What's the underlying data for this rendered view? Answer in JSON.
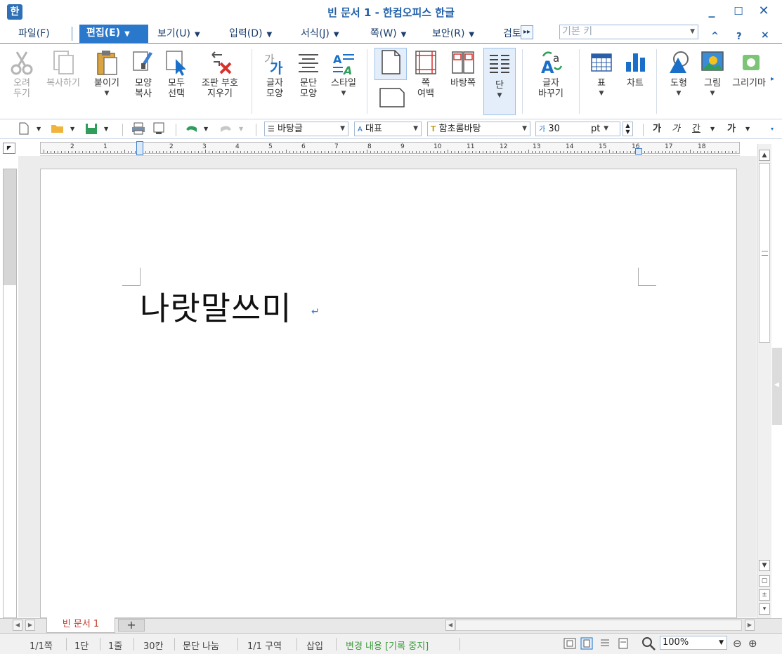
{
  "window": {
    "title": "빈 문서 1 - 한컴오피스 한글",
    "minimize": "_",
    "maximize": "☐",
    "close": "✕",
    "app_icon": "한"
  },
  "menu": {
    "items": [
      {
        "label": "파일(F)"
      },
      {
        "label": "편집(E)"
      },
      {
        "label": "보기(U)"
      },
      {
        "label": "입력(D)"
      },
      {
        "label": "서식(J)"
      },
      {
        "label": "쪽(W)"
      },
      {
        "label": "보안(R)"
      },
      {
        "label": "검토"
      }
    ],
    "more": "▸▸",
    "key_placeholder": "기본 키",
    "help": "?",
    "collapse": "^",
    "doc_close": "×"
  },
  "ribbon": {
    "cut": "오려\n두기",
    "copy": "복사하기",
    "paste": "붙이기",
    "format_copy": "모양\n복사",
    "select_all": "모두\n선택",
    "remove_markup": "조판 부호\n지우기",
    "char_shape": "글자\n모양",
    "para_shape": "문단\n모양",
    "style": "스타일",
    "page_margin": "쪽\n여백",
    "master_page": "바탕쪽",
    "columns": "단",
    "change_char": "글자\n바꾸기",
    "table": "표",
    "chart": "차트",
    "shape": "도형",
    "picture": "그림",
    "drawing": "그리기마"
  },
  "format": {
    "style": "바탕글",
    "language": "대표",
    "font": "함초롬바탕",
    "size": "30",
    "unit": "pt",
    "bold": "가",
    "italic": "가",
    "underline": "간",
    "strike": "가"
  },
  "ruler": {
    "h_ticks": [
      "2",
      "1",
      "1",
      "2",
      "3",
      "4",
      "5",
      "6",
      "7",
      "8",
      "9",
      "10",
      "11",
      "12",
      "13",
      "14",
      "15",
      "16",
      "17",
      "18"
    ]
  },
  "document": {
    "text": "나랏말쓰미",
    "para_mark": "↵"
  },
  "tabs": {
    "doc_tab": "빈 문서 1",
    "add_tab": "+"
  },
  "status": {
    "page": "1/1쪽",
    "column": "1단",
    "line": "1줄",
    "col_pos": "30칸",
    "break": "문단 나눔",
    "section": "1/1 구역",
    "insert_mode": "삽입",
    "track_changes": "변경 내용 [기록 중지]",
    "zoom": "100%"
  }
}
